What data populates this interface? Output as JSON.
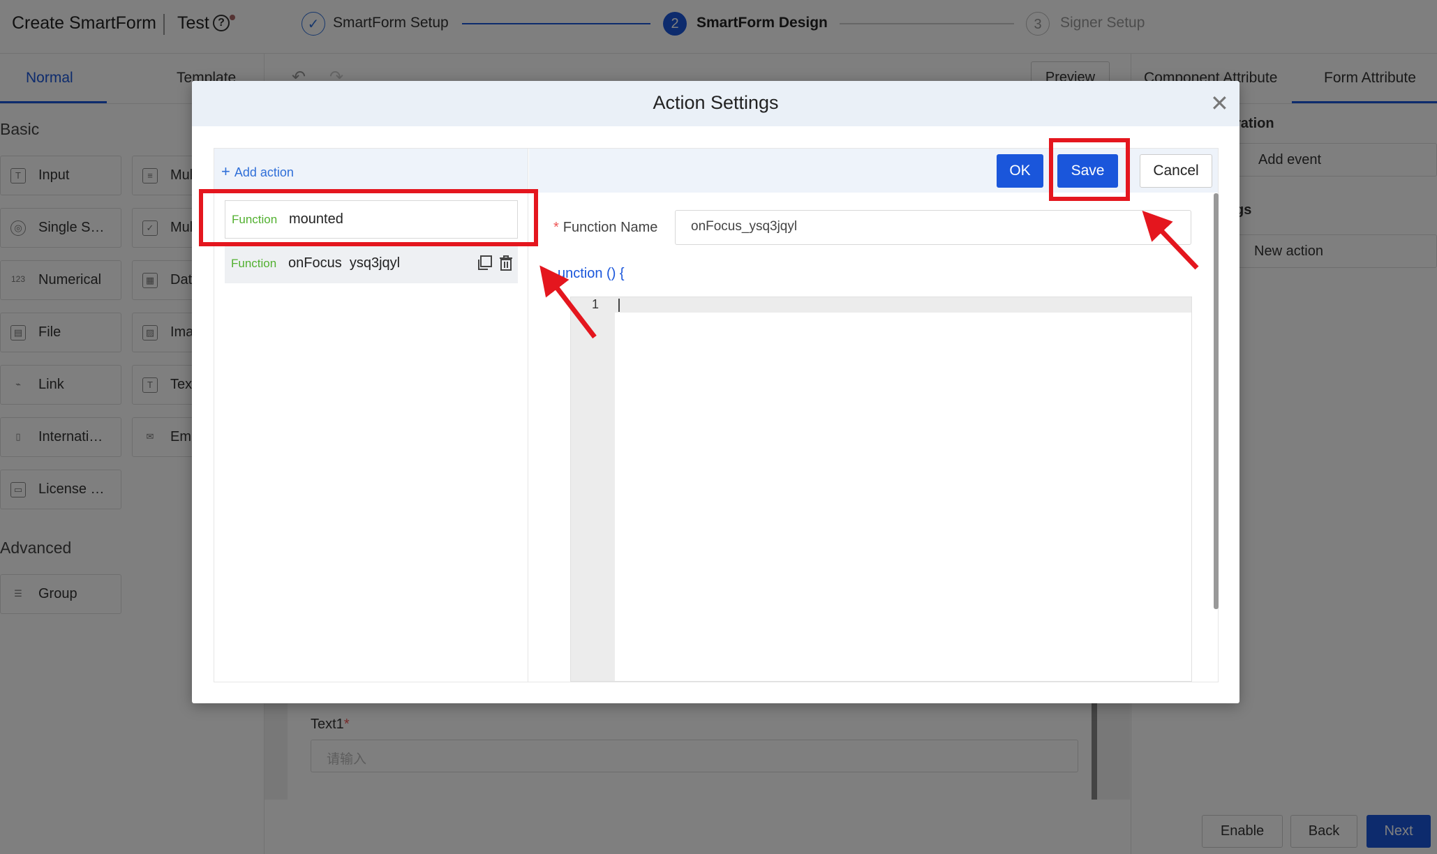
{
  "header": {
    "title": "Create SmartForm",
    "form_name": "Test",
    "help_glyph": "?",
    "steps": [
      {
        "num": "✓",
        "label": "SmartForm Setup",
        "state": "done"
      },
      {
        "num": "2",
        "label": "SmartForm Design",
        "state": "active"
      },
      {
        "num": "3",
        "label": "Signer Setup",
        "state": "pending"
      }
    ]
  },
  "sidebar": {
    "tabs": [
      "Normal",
      "Template"
    ],
    "basic_title": "Basic",
    "advanced_title": "Advanced",
    "basic_items": [
      {
        "label": "Input",
        "icon": "T"
      },
      {
        "label": "Mul",
        "icon": "≡"
      },
      {
        "label": "Single S…",
        "icon": "◎"
      },
      {
        "label": "Mul",
        "icon": "✓"
      },
      {
        "label": "Numerical",
        "icon": "123"
      },
      {
        "label": "Dat",
        "icon": "▦"
      },
      {
        "label": "File",
        "icon": "▤"
      },
      {
        "label": "Ima",
        "icon": "▨"
      },
      {
        "label": "Link",
        "icon": "⌁"
      },
      {
        "label": "Tex",
        "icon": "T"
      },
      {
        "label": "Internati…",
        "icon": "▯"
      },
      {
        "label": "Em",
        "icon": "✉"
      },
      {
        "label": "License …",
        "icon": "▭"
      }
    ],
    "advanced_items": [
      {
        "label": "Group",
        "icon": "☰"
      }
    ]
  },
  "canvas": {
    "preview_label": "Preview",
    "field_label": "Text1",
    "field_required": "*",
    "field_placeholder": "请输入"
  },
  "right_panel": {
    "tabs": [
      "Component Attribute",
      "Form Attribute"
    ],
    "section1": "ration",
    "add_event_label": "Add event",
    "section2": "gs",
    "new_action_label": "New action"
  },
  "footer": {
    "enable_label": "Enable",
    "back_label": "Back",
    "next_label": "Next"
  },
  "dialog": {
    "title": "Action Settings",
    "close_glyph": "✕",
    "add_action_label": "Add action",
    "functions": [
      {
        "tag": "Function",
        "name": "mounted"
      },
      {
        "tag": "Function",
        "name": "onFocus  ysq3jqyl"
      }
    ],
    "ok_label": "OK",
    "save_label": "Save",
    "cancel_label": "Cancel",
    "function_name_label": "Function Name",
    "function_name_required": "*",
    "function_name_value": "onFocus_ysq3jqyl",
    "code_header": "unction () {",
    "code_line_number": "1"
  },
  "colors": {
    "accent": "#1a56db",
    "highlight": "#e4161e",
    "function_tag": "#52b030"
  }
}
